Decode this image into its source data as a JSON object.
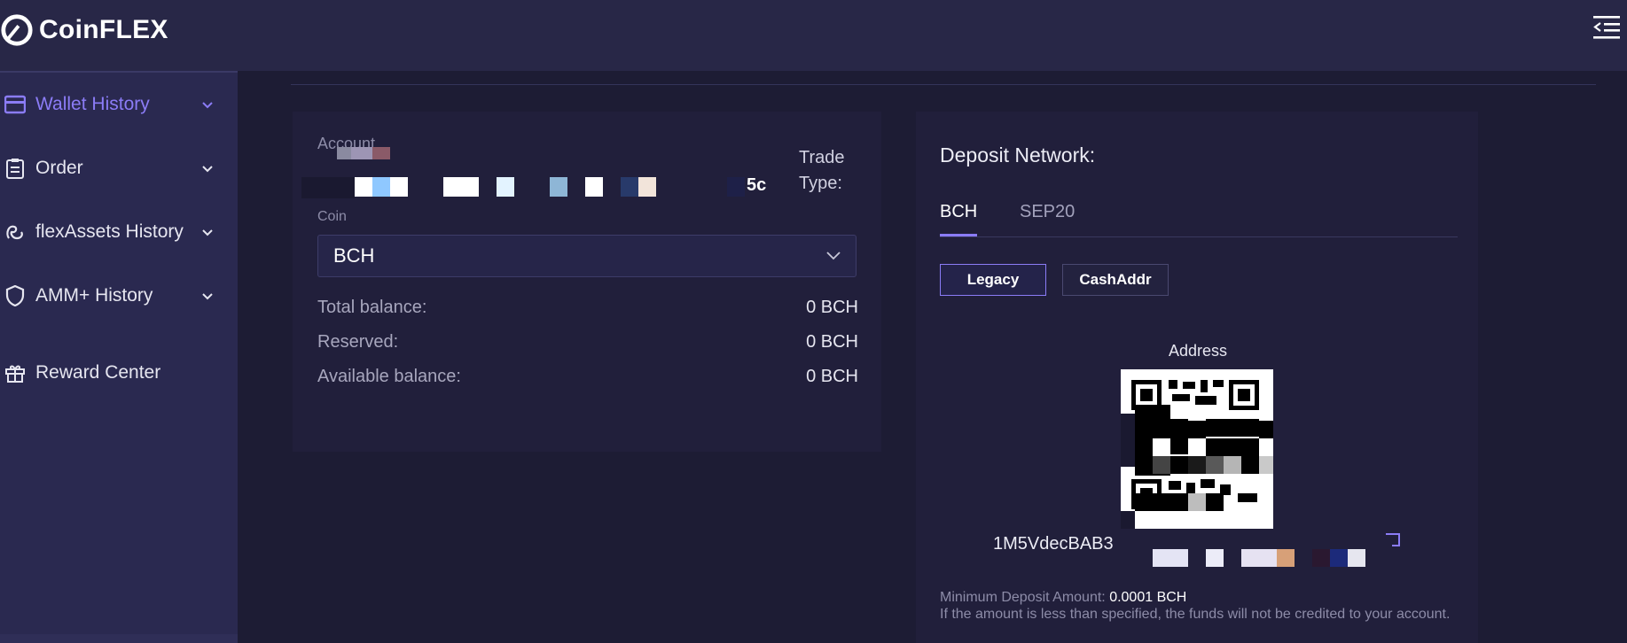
{
  "app": {
    "name": "CoinFLEX",
    "icons": {
      "logo": "coinflex-logo-icon",
      "menu": "collapse-menu-icon"
    }
  },
  "sidebar": {
    "items": [
      {
        "label": "Wallet History",
        "icon": "wallet-icon",
        "active": true,
        "expandable": true
      },
      {
        "label": "Order",
        "icon": "clipboard-icon",
        "active": false,
        "expandable": true
      },
      {
        "label": "flexAssets History",
        "icon": "flex-icon",
        "active": false,
        "expandable": true
      },
      {
        "label": "AMM+ History",
        "icon": "shield-icon",
        "active": false,
        "expandable": true
      },
      {
        "label": "Reward Center",
        "icon": "gift-icon",
        "active": false,
        "expandable": false
      }
    ]
  },
  "account_panel": {
    "account_label": "Account",
    "account_value_suffix": "5c",
    "trade_type_label": "Trade Type:",
    "coin_label": "Coin",
    "coin_value": "BCH",
    "balances": [
      {
        "label": "Total balance:",
        "value": "0 BCH"
      },
      {
        "label": "Reserved:",
        "value": "0 BCH"
      },
      {
        "label": "Available balance:",
        "value": "0 BCH"
      }
    ]
  },
  "deposit_panel": {
    "title": "Deposit Network:",
    "tabs": [
      {
        "label": "BCH",
        "active": true
      },
      {
        "label": "SEP20",
        "active": false
      }
    ],
    "address_formats": [
      {
        "label": "Legacy",
        "active": true
      },
      {
        "label": "CashAddr",
        "active": false
      }
    ],
    "address_label": "Address",
    "address_prefix": "1M5VdecBAB3",
    "min_deposit_label": "Minimum Deposit Amount:",
    "min_deposit_value": "0.0001 BCH",
    "warning": "If the amount is less than specified, the funds will not be credited to your account."
  },
  "colors": {
    "accent": "#8b7cf6",
    "background": "#1c1b33",
    "sidebar": "#2a2950",
    "card": "#211f3b"
  }
}
